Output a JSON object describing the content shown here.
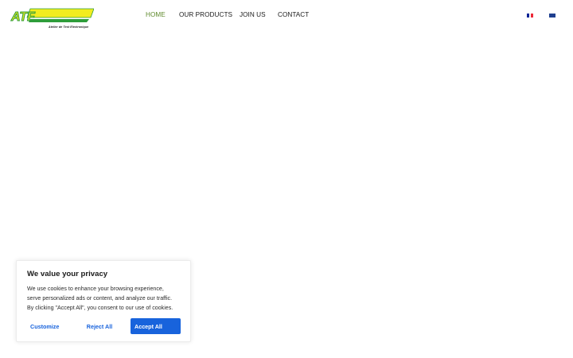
{
  "logo": {
    "text": "ATF",
    "caption": "Atelier de Test Electronique"
  },
  "nav": {
    "items": [
      {
        "label": "HOME",
        "active": true
      },
      {
        "label": "OUR PRODUCTS",
        "active": false
      },
      {
        "label": "JOIN US",
        "active": false
      },
      {
        "label": "CONTACT",
        "active": false
      }
    ]
  },
  "languages": [
    {
      "icon": "flag-fr-icon",
      "colors": [
        "#002395",
        "#ffffff",
        "#ed2939"
      ]
    },
    {
      "icon": "flag-gb-icon",
      "colors": [
        "#012169",
        "#ffffff",
        "#c8102e"
      ]
    }
  ],
  "cookie_banner": {
    "title": "We value your privacy",
    "text_lines": [
      "We use cookies to enhance your browsing experience,",
      "serve personalized ads or content, and analyze our traffic.",
      "By clicking \"Accept All\", you consent to our use of cookies."
    ],
    "customize_label": "Customize",
    "reject_label": "Reject All",
    "accept_label": "Accept All"
  },
  "colors": {
    "nav_active": "#5f8a2c",
    "logo_yellow": "#f2ec1f",
    "logo_green": "#2e9d3a",
    "button_blue": "#1863dc"
  }
}
